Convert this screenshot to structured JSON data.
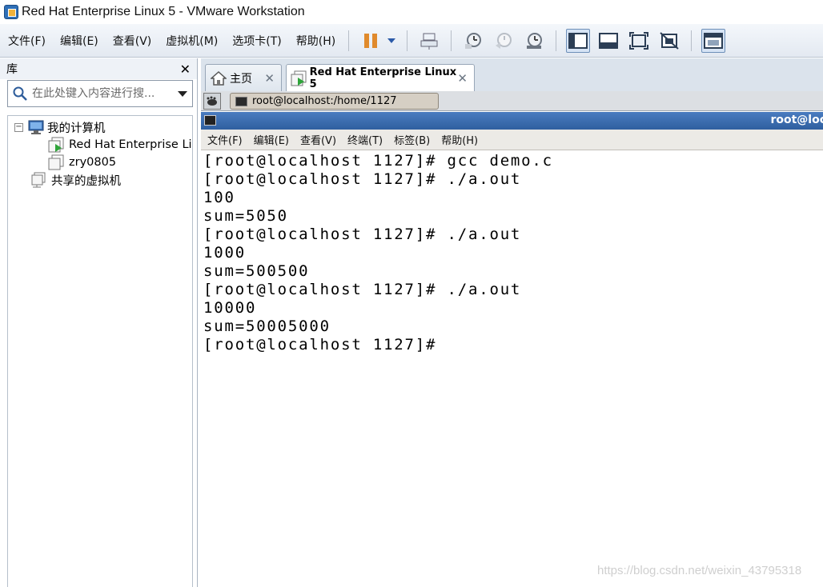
{
  "window": {
    "title": "Red Hat Enterprise Linux 5 - VMware Workstation"
  },
  "menu": [
    {
      "label": "文件(F)"
    },
    {
      "label": "编辑(E)"
    },
    {
      "label": "查看(V)"
    },
    {
      "label": "虚拟机(M)"
    },
    {
      "label": "选项卡(T)"
    },
    {
      "label": "帮助(H)"
    }
  ],
  "toolbar": {
    "icons": [
      "pause-icon",
      "dropdown-arrow-icon",
      "send-ctrl-alt-del-icon",
      "snapshot-take-icon",
      "snapshot-revert-icon",
      "snapshot-manager-icon",
      "view-sidebar-icon",
      "view-console-icon",
      "fullscreen-icon",
      "unity-icon",
      "thumbnail-view-icon"
    ],
    "pause_color": "#e08a2c"
  },
  "library": {
    "title": "库",
    "close": "✕",
    "search_placeholder": "在此处键入内容进行搜...",
    "tree": [
      {
        "label": "我的计算机",
        "expander": "−"
      },
      {
        "label": "Red Hat Enterprise Li"
      },
      {
        "label": "zry0805"
      },
      {
        "label": "共享的虚拟机"
      }
    ]
  },
  "tabs": [
    {
      "label": "主页",
      "close": "✕"
    },
    {
      "label": "Red Hat Enterprise Linux 5",
      "close": "✕"
    }
  ],
  "console": {
    "tab_label": "root@localhost:/home/1127"
  },
  "guest": {
    "window_title": "root@loc",
    "menu": [
      "文件(F)",
      "编辑(E)",
      "查看(V)",
      "终端(T)",
      "标签(B)",
      "帮助(H)"
    ],
    "terminal_lines": [
      "[root@localhost 1127]# gcc demo.c",
      "[root@localhost 1127]# ./a.out",
      "100",
      "sum=5050",
      "[root@localhost 1127]# ./a.out",
      "1000",
      "sum=500500",
      "[root@localhost 1127]# ./a.out",
      "10000",
      "sum=50005000",
      "[root@localhost 1127]#"
    ]
  },
  "watermark": "https://blog.csdn.net/weixin_43795318"
}
